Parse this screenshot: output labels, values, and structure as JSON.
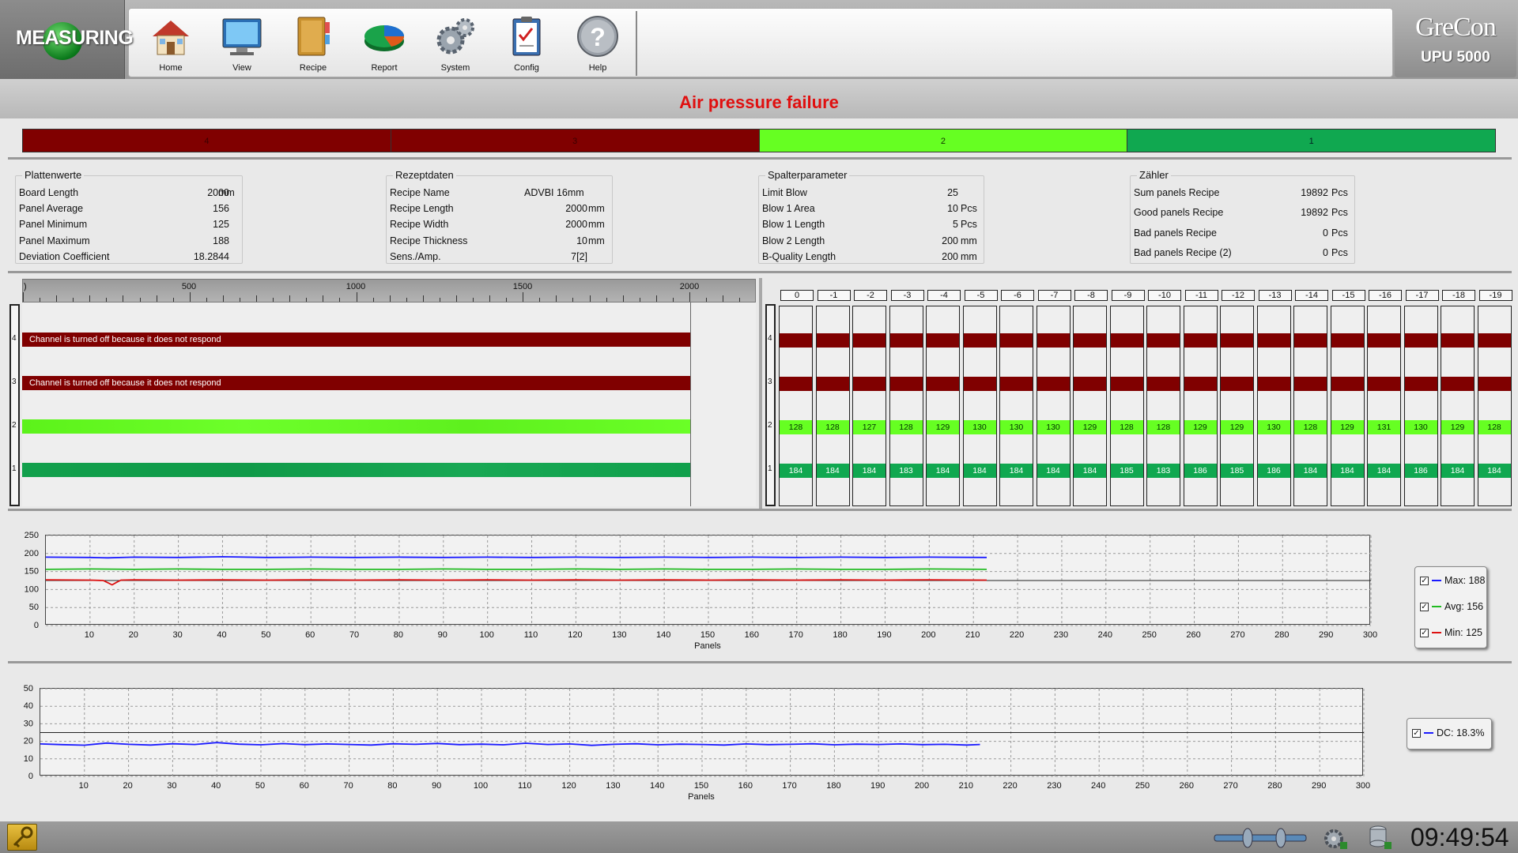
{
  "app": {
    "mode_label": "MEASURING",
    "brand_name": "GreCon",
    "brand_model": "UPU 5000"
  },
  "toolbar": {
    "items": [
      {
        "label": "Home",
        "icon": "home-icon"
      },
      {
        "label": "View",
        "icon": "monitor-icon"
      },
      {
        "label": "Recipe",
        "icon": "recipe-book-icon"
      },
      {
        "label": "Report",
        "icon": "pie-chart-icon"
      },
      {
        "label": "System",
        "icon": "gears-icon"
      },
      {
        "label": "Config",
        "icon": "clipboard-icon"
      },
      {
        "label": "Help",
        "icon": "help-icon"
      }
    ]
  },
  "alarm": {
    "message": "Air pressure failure",
    "color": "#e01010"
  },
  "channels": [
    {
      "label": "4",
      "status": "off",
      "color": "#800000"
    },
    {
      "label": "3",
      "status": "off",
      "color": "#800000"
    },
    {
      "label": "2",
      "status": "ok",
      "color": "#66ff22"
    },
    {
      "label": "1",
      "status": "ok",
      "color": "#10a850"
    }
  ],
  "groups": [
    {
      "title": "Plattenwerte",
      "rows": [
        {
          "label": "Board Length",
          "value": "2000",
          "unit": "mm"
        },
        {
          "label": "Panel Average",
          "value": "156",
          "unit": ""
        },
        {
          "label": "Panel Minimum",
          "value": "125",
          "unit": ""
        },
        {
          "label": "Panel Maximum",
          "value": "188",
          "unit": ""
        },
        {
          "label": "Deviation Coefficient",
          "value": "18.2844",
          "unit": ""
        }
      ]
    },
    {
      "title": "Rezeptdaten",
      "rows": [
        {
          "label": "Recipe Name",
          "value": "ADVBI 16mm",
          "unit": ""
        },
        {
          "label": "Recipe Length",
          "value": "2000",
          "unit": "mm"
        },
        {
          "label": "Recipe Width",
          "value": "2000",
          "unit": "mm"
        },
        {
          "label": "Recipe Thickness",
          "value": "10",
          "unit": "mm"
        },
        {
          "label": "Sens./Amp.",
          "value": "7[2]",
          "unit": ""
        }
      ]
    },
    {
      "title": "Spalterparameter",
      "rows": [
        {
          "label": "Limit Blow",
          "value": "25",
          "unit": ""
        },
        {
          "label": "Blow 1 Area",
          "value": "10",
          "unit": "Pcs"
        },
        {
          "label": "Blow 1 Length",
          "value": "5",
          "unit": "Pcs"
        },
        {
          "label": "Blow 2 Length",
          "value": "200",
          "unit": "mm"
        },
        {
          "label": "B-Quality Length",
          "value": "200",
          "unit": "mm"
        }
      ]
    },
    {
      "title": "Zähler",
      "rows": [
        {
          "label": "Sum panels Recipe",
          "value": "19892",
          "unit": "Pcs"
        },
        {
          "label": "Good panels Recipe",
          "value": "19892",
          "unit": "Pcs"
        },
        {
          "label": "Bad panels Recipe",
          "value": "0",
          "unit": "Pcs"
        },
        {
          "label": "Bad panels Recipe (2)",
          "value": "0",
          "unit": "Pcs"
        }
      ]
    }
  ],
  "ruler": {
    "labels": [
      "500",
      "1000",
      "1500",
      "2000"
    ],
    "start_label": ")"
  },
  "channel_messages": {
    "ch4": "Channel is turned off because it does not respond",
    "ch3": "Channel is turned off because it does not respond"
  },
  "axis_labels": [
    "4",
    "3",
    "2",
    "1"
  ],
  "history": {
    "columns": [
      "0",
      "-1",
      "-2",
      "-3",
      "-4",
      "-5",
      "-6",
      "-7",
      "-8",
      "-9",
      "-10",
      "-11",
      "-12",
      "-13",
      "-14",
      "-15",
      "-16",
      "-17",
      "-18",
      "-19"
    ],
    "ch2": [
      "128",
      "128",
      "127",
      "128",
      "129",
      "130",
      "130",
      "130",
      "129",
      "128",
      "128",
      "129",
      "129",
      "130",
      "128",
      "129",
      "131",
      "130",
      "129",
      "128"
    ],
    "ch1": [
      "184",
      "184",
      "184",
      "183",
      "184",
      "184",
      "184",
      "184",
      "184",
      "185",
      "183",
      "186",
      "185",
      "186",
      "184",
      "184",
      "184",
      "186",
      "184",
      "184"
    ]
  },
  "chart_data": [
    {
      "type": "line",
      "title": "",
      "xlabel": "Panels",
      "ylabel": "",
      "xlim": [
        0,
        300
      ],
      "ylim": [
        0,
        250
      ],
      "xticks": [
        10,
        20,
        30,
        40,
        50,
        60,
        70,
        80,
        90,
        100,
        110,
        120,
        130,
        140,
        150,
        160,
        170,
        180,
        190,
        200,
        210,
        220,
        230,
        240,
        250,
        260,
        270,
        280,
        290,
        300
      ],
      "yticks": [
        0,
        50,
        100,
        150,
        200,
        250
      ],
      "threshold": 125,
      "grid": true,
      "series": [
        {
          "name": "Max",
          "color": "#1a1aff",
          "x": [
            0,
            10,
            14,
            20,
            30,
            40,
            50,
            60,
            70,
            80,
            90,
            100,
            110,
            120,
            130,
            140,
            150,
            160,
            170,
            180,
            190,
            200,
            213
          ],
          "y": [
            190,
            189,
            188,
            190,
            189,
            191,
            189,
            190,
            189,
            190,
            189,
            190,
            189,
            190,
            189,
            190,
            189,
            190,
            189,
            190,
            189,
            190,
            189
          ]
        },
        {
          "name": "Avg",
          "color": "#22bb22",
          "x": [
            0,
            10,
            20,
            30,
            40,
            50,
            60,
            70,
            80,
            90,
            100,
            110,
            120,
            130,
            140,
            150,
            160,
            170,
            180,
            190,
            200,
            213
          ],
          "y": [
            156,
            157,
            156,
            157,
            156,
            156,
            157,
            156,
            156,
            157,
            156,
            156,
            157,
            156,
            157,
            156,
            156,
            157,
            156,
            156,
            157,
            156
          ]
        },
        {
          "name": "Min",
          "color": "#dd1111",
          "x": [
            0,
            10,
            13,
            14,
            15,
            16,
            17,
            20,
            30,
            40,
            50,
            60,
            70,
            80,
            90,
            100,
            110,
            120,
            130,
            140,
            150,
            160,
            170,
            180,
            190,
            200,
            213
          ],
          "y": [
            127,
            126,
            125,
            119,
            113,
            120,
            126,
            127,
            126,
            127,
            126,
            127,
            126,
            127,
            126,
            127,
            126,
            127,
            126,
            127,
            126,
            127,
            126,
            127,
            126,
            127,
            126
          ]
        }
      ],
      "legend": [
        {
          "name": "Max",
          "value_label": "Max: 188"
        },
        {
          "name": "Avg",
          "value_label": "Avg: 156"
        },
        {
          "name": "Min",
          "value_label": "Min: 125"
        }
      ]
    },
    {
      "type": "line",
      "title": "",
      "xlabel": "Panels",
      "ylabel": "",
      "xlim": [
        0,
        300
      ],
      "ylim": [
        0,
        50
      ],
      "xticks": [
        10,
        20,
        30,
        40,
        50,
        60,
        70,
        80,
        90,
        100,
        110,
        120,
        130,
        140,
        150,
        160,
        170,
        180,
        190,
        200,
        210,
        220,
        230,
        240,
        250,
        260,
        270,
        280,
        290,
        300
      ],
      "yticks": [
        0,
        10,
        20,
        30,
        40,
        50
      ],
      "threshold": 25,
      "grid": true,
      "series": [
        {
          "name": "DC",
          "color": "#1a1aff",
          "x": [
            0,
            5,
            10,
            15,
            20,
            25,
            30,
            35,
            40,
            45,
            50,
            55,
            60,
            65,
            70,
            75,
            80,
            85,
            90,
            95,
            100,
            105,
            110,
            115,
            120,
            125,
            130,
            135,
            140,
            145,
            150,
            155,
            160,
            165,
            170,
            175,
            180,
            185,
            190,
            195,
            200,
            205,
            210,
            213
          ],
          "y": [
            18.5,
            18.1,
            17.8,
            19.0,
            18.3,
            17.9,
            18.6,
            18.2,
            19.3,
            18.4,
            18.0,
            18.7,
            18.1,
            18.5,
            18.2,
            17.9,
            18.6,
            18.3,
            18.8,
            18.1,
            18.4,
            18.0,
            18.9,
            18.2,
            18.5,
            17.7,
            18.3,
            18.6,
            18.0,
            18.4,
            18.2,
            17.9,
            18.5,
            18.1,
            18.3,
            18.6,
            18.0,
            18.4,
            18.2,
            18.5,
            18.1,
            18.3,
            17.9,
            18.2
          ]
        }
      ],
      "legend": [
        {
          "name": "DC",
          "value_label": "DC: 18.3%"
        }
      ]
    }
  ],
  "status": {
    "clock": "09:49:54",
    "colors": {
      "key": "#d4a21c"
    }
  }
}
